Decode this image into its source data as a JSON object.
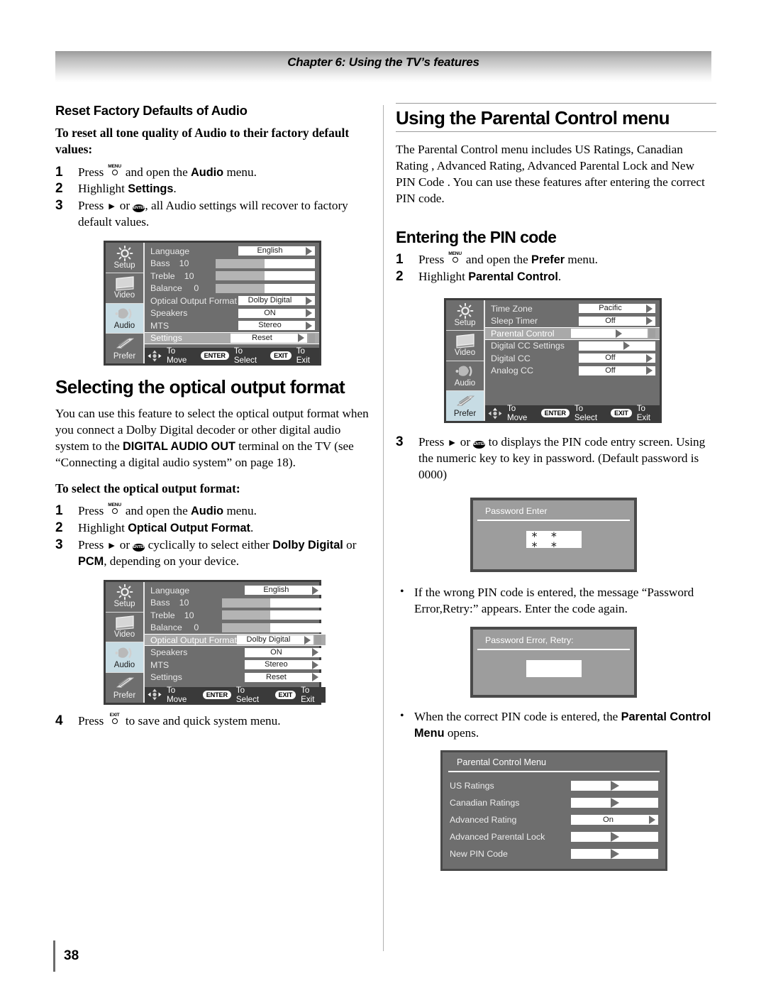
{
  "header": {
    "chapter": "Chapter 6: Using the TV’s features"
  },
  "footer": {
    "page_number": "38"
  },
  "left": {
    "section1_title": "Reset Factory Defaults of Audio",
    "section1_leadin": "To reset all tone quality of Audio to their factory default values:",
    "section1_steps": [
      {
        "num": "1",
        "pre": "Press ",
        "key": "MENU",
        "post": " and open the ",
        "bold": "Audio",
        "tail": " menu."
      },
      {
        "num": "2",
        "pre": "Highlight ",
        "bold": "Settings",
        "tail": "."
      },
      {
        "num": "3",
        "pre": "Press ",
        "key": "ARROW_ENTER",
        "post": ", all Audio settings will recover to factory default values."
      }
    ],
    "section2_title": "Selecting the optical output format",
    "section2_body_1": "You can use this feature to select the optical output format when you connect a Dolby Digital decoder or other digital audio system to the ",
    "section2_body_bold": "DIGITAL AUDIO OUT",
    "section2_body_2": " terminal on the TV (see “Connecting a digital audio system” on page 18).",
    "section2_leadin": "To select the optical output format:",
    "section2_steps": [
      {
        "num": "1",
        "pre": "Press ",
        "key": "MENU",
        "post": " and open the ",
        "bold": "Audio",
        "tail": " menu."
      },
      {
        "num": "2",
        "pre": "Highlight ",
        "bold": "Optical Output Format",
        "tail": "."
      },
      {
        "num": "3",
        "pre": "Press ",
        "key": "ARROW_ENTER",
        "post": " cyclically to select either ",
        "bold": "Dolby Digital",
        "mid": " or ",
        "bold2": "PCM",
        "tail": ", depending on your device."
      },
      {
        "num": "4",
        "pre": "Press ",
        "key": "EXIT",
        "post": " to save and quick system menu."
      }
    ]
  },
  "right": {
    "section1_title": "Using the Parental Control menu",
    "section1_body": "The Parental Control menu includes US Ratings, Canadian Rating , Advanced Rating, Advanced Parental Lock and New PIN Code . You can use these features after entering the correct PIN code.",
    "section2_title": "Entering the PIN code",
    "section2_steps": [
      {
        "num": "1",
        "pre": "Press ",
        "key": "MENU",
        "post": " and open the ",
        "bold": "Prefer",
        "tail": " menu."
      },
      {
        "num": "2",
        "pre": "Highlight ",
        "bold": "Parental Control",
        "tail": "."
      },
      {
        "num": "3",
        "pre": "Press ",
        "key": "ARROW_ENTER",
        "post": " to displays the PIN code entry screen. Using the numeric key to key in password. (Default password is 0000)"
      }
    ],
    "bullets": [
      {
        "text": "If the wrong PIN code is entered, the message “Password Error,Retry:” appears. Enter the code again."
      },
      {
        "pre": "When the correct PIN code is entered, the ",
        "bold": "Parental Control Menu",
        "tail": " opens."
      }
    ]
  },
  "osd_audio_settings": {
    "sidebar": [
      {
        "label": "Setup",
        "icon": "sun-icon",
        "active": false
      },
      {
        "label": "Video",
        "icon": "tv-icon",
        "active": false
      },
      {
        "label": "Audio",
        "icon": "speaker-icon",
        "active": true
      },
      {
        "label": "Prefer",
        "icon": "list-icon",
        "active": false
      }
    ],
    "rows": [
      {
        "label": "Language",
        "type": "field",
        "value": "English",
        "selected": false
      },
      {
        "label": "Bass",
        "type": "slider",
        "num": "10",
        "fill_pct": 49,
        "selected": false
      },
      {
        "label": "Treble",
        "type": "slider",
        "num": "10",
        "fill_pct": 49,
        "selected": false
      },
      {
        "label": "Balance",
        "type": "slider",
        "num": "0",
        "fill_pct": 49,
        "selected": false
      },
      {
        "label": "Optical Output Format",
        "type": "field",
        "value": "Dolby Digital",
        "selected": false
      },
      {
        "label": "Speakers",
        "type": "field",
        "value": "ON",
        "selected": false
      },
      {
        "label": "MTS",
        "type": "field",
        "value": "Stereo",
        "selected": false
      },
      {
        "label": "Settings",
        "type": "field",
        "value": "Reset",
        "selected": true
      }
    ],
    "footer": {
      "move": "To Move",
      "enter_key": "ENTER",
      "select": "To Select",
      "exit_key": "EXIT",
      "exit": "To Exit"
    }
  },
  "osd_audio_optical": {
    "sidebar": [
      {
        "label": "Setup",
        "icon": "sun-icon",
        "active": false
      },
      {
        "label": "Video",
        "icon": "tv-icon",
        "active": false
      },
      {
        "label": "Audio",
        "icon": "speaker-icon",
        "active": true
      },
      {
        "label": "Prefer",
        "icon": "list-icon",
        "active": false
      }
    ],
    "rows": [
      {
        "label": "Language",
        "type": "field",
        "value": "English",
        "selected": false
      },
      {
        "label": "Bass",
        "type": "slider",
        "num": "10",
        "fill_pct": 49,
        "selected": false
      },
      {
        "label": "Treble",
        "type": "slider",
        "num": "10",
        "fill_pct": 49,
        "selected": false
      },
      {
        "label": "Balance",
        "type": "slider",
        "num": "0",
        "fill_pct": 49,
        "selected": false
      },
      {
        "label": "Optical Output Format",
        "type": "field",
        "value": "Dolby Digital",
        "selected": true
      },
      {
        "label": "Speakers",
        "type": "field",
        "value": "ON",
        "selected": false
      },
      {
        "label": "MTS",
        "type": "field",
        "value": "Stereo",
        "selected": false
      },
      {
        "label": "Settings",
        "type": "field",
        "value": "Reset",
        "selected": false
      }
    ],
    "footer": {
      "move": "To Move",
      "enter_key": "ENTER",
      "select": "To Select",
      "exit_key": "EXIT",
      "exit": "To Exit"
    }
  },
  "osd_prefer": {
    "sidebar": [
      {
        "label": "Setup",
        "icon": "sun-icon",
        "active": false
      },
      {
        "label": "Video",
        "icon": "tv-icon",
        "active": false
      },
      {
        "label": "Audio",
        "icon": "speaker-icon",
        "active": false
      },
      {
        "label": "Prefer",
        "icon": "list-icon",
        "active": true
      }
    ],
    "rows": [
      {
        "label": "Time Zone",
        "type": "field",
        "value": "Pacific",
        "selected": false
      },
      {
        "label": "Sleep Timer",
        "type": "field",
        "value": "Off",
        "selected": false
      },
      {
        "label": "Parental Control",
        "type": "field",
        "value": "",
        "selected": true
      },
      {
        "label": "Digital CC Settings",
        "type": "field",
        "value": "",
        "selected": false
      },
      {
        "label": "Digital CC",
        "type": "field",
        "value": "Off",
        "selected": false
      },
      {
        "label": "Analog CC",
        "type": "field",
        "value": "Off",
        "selected": false
      }
    ],
    "footer": {
      "move": "To Move",
      "enter_key": "ENTER",
      "select": "To Select",
      "exit_key": "EXIT",
      "exit": "To Exit"
    }
  },
  "password_enter": {
    "title": "Password Enter",
    "value": "∗ ∗ ∗ ∗"
  },
  "password_error": {
    "title": "Password Error, Retry:",
    "value": ""
  },
  "parental_control_menu": {
    "title": "Parental Control Menu",
    "rows": [
      {
        "label": "US Ratings",
        "value": ""
      },
      {
        "label": "Canadian Ratings",
        "value": ""
      },
      {
        "label": "Advanced Rating",
        "value": "On"
      },
      {
        "label": "Advanced Parental Lock",
        "value": ""
      },
      {
        "label": "New PIN Code",
        "value": ""
      }
    ]
  },
  "colors": {
    "osd_bg": "#6e6e6e",
    "osd_border": "#3c3c3c",
    "osd_active_tab": "#c7dce4",
    "osd_selected_row": "#a9a9a9",
    "osd_footer": "#3a3a3a",
    "dialog_bg": "#9d9d9d",
    "rule": "#9a9a9a"
  }
}
